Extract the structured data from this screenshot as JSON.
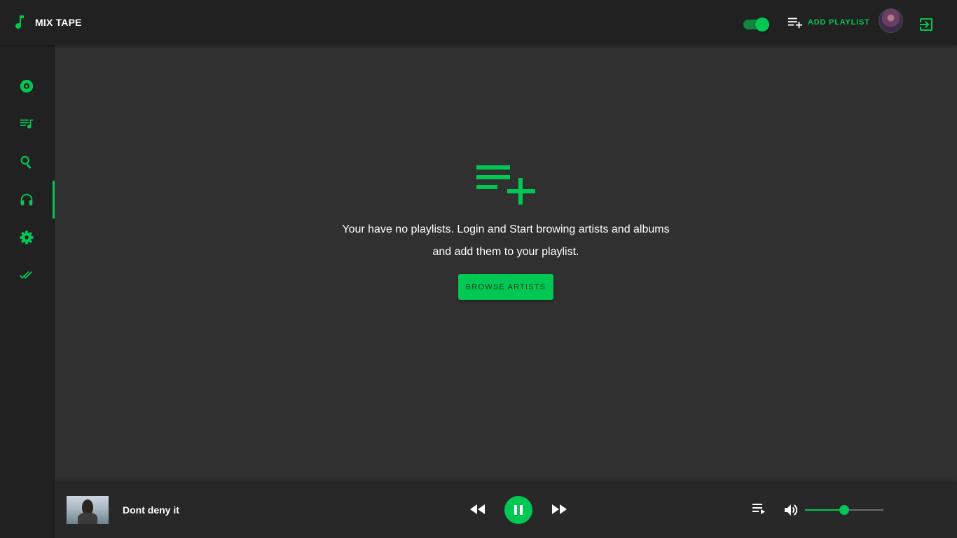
{
  "app": {
    "title": "MIX TAPE"
  },
  "header": {
    "dark_mode_toggle": {
      "on": true
    },
    "add_playlist_label": "ADD PLAYLIST"
  },
  "sidebar": {
    "items": [
      {
        "name": "albums",
        "icon": "disc-icon",
        "active": false
      },
      {
        "name": "playlists",
        "icon": "playlist-music-icon",
        "active": false
      },
      {
        "name": "search",
        "icon": "search-icon",
        "active": false
      },
      {
        "name": "listening",
        "icon": "headphones-icon",
        "active": true
      },
      {
        "name": "settings",
        "icon": "gear-icon",
        "active": false
      },
      {
        "name": "done",
        "icon": "double-check-icon",
        "active": false
      }
    ]
  },
  "main": {
    "empty_icon": "playlist-add-icon",
    "empty_line1": "Your have no playlists. Login and Start browing artists and albums",
    "empty_line2": "and add them to your playlist.",
    "browse_button": "BROWSE ARTISTS"
  },
  "player": {
    "track_title": "Dont deny it",
    "is_playing": true,
    "volume": 0.5
  },
  "colors": {
    "accent": "#00c853",
    "background": "#303030",
    "bars": "#212121",
    "player": "#282828"
  }
}
